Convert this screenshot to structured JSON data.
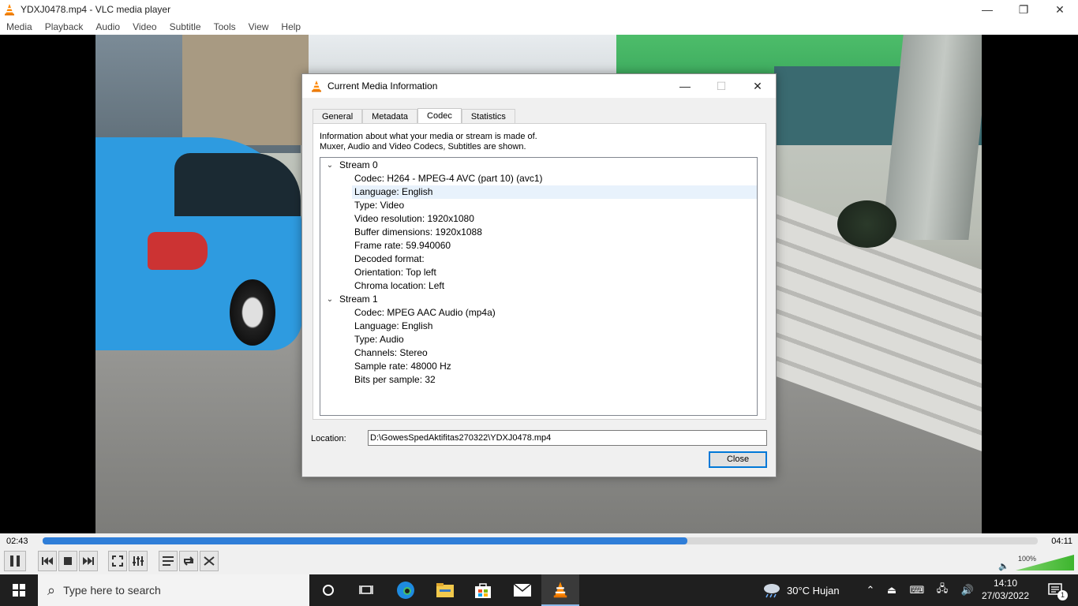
{
  "window": {
    "title": "YDXJ0478.mp4 - VLC media player",
    "minimize": "—",
    "maximize": "❐",
    "close": "✕"
  },
  "menu": [
    "Media",
    "Playback",
    "Audio",
    "Video",
    "Subtitle",
    "Tools",
    "View",
    "Help"
  ],
  "dialog": {
    "title": "Current Media Information",
    "tabs": [
      "General",
      "Metadata",
      "Codec",
      "Statistics"
    ],
    "active_tab": "Codec",
    "info_line1": "Information about what your media or stream is made of.",
    "info_line2": "Muxer, Audio and Video Codecs, Subtitles are shown.",
    "streams": [
      {
        "label": "Stream 0",
        "items": [
          "Codec: H264 - MPEG-4 AVC (part 10) (avc1)",
          "Language: English",
          "Type: Video",
          "Video resolution: 1920x1080",
          "Buffer dimensions: 1920x1088",
          "Frame rate: 59.940060",
          "Decoded format:",
          "Orientation: Top left",
          "Chroma location: Left"
        ]
      },
      {
        "label": "Stream 1",
        "items": [
          "Codec: MPEG AAC Audio (mp4a)",
          "Language: English",
          "Type: Audio",
          "Channels: Stereo",
          "Sample rate: 48000 Hz",
          "Bits per sample: 32"
        ]
      }
    ],
    "location_label": "Location:",
    "location_value": "D:\\GowesSpedAktifitas270322\\YDXJ0478.mp4",
    "close_label": "Close"
  },
  "player": {
    "time_current": "02:43",
    "time_total": "04:11",
    "progress_fraction": 0.648,
    "volume_label": "100%",
    "volume_fraction": 1.0
  },
  "taskbar": {
    "search_placeholder": "Type here to search",
    "weather": "30°C  Hujan",
    "time": "14:10",
    "date": "27/03/2022",
    "notification_count": "1"
  },
  "icons": {
    "vlc": "vlc-cone-icon",
    "start": "windows-start-icon",
    "search": "search-icon"
  },
  "colors": {
    "accent": "#0078d7",
    "seek_fill": "#2f7ed8",
    "vlc_orange": "#ff8800"
  }
}
